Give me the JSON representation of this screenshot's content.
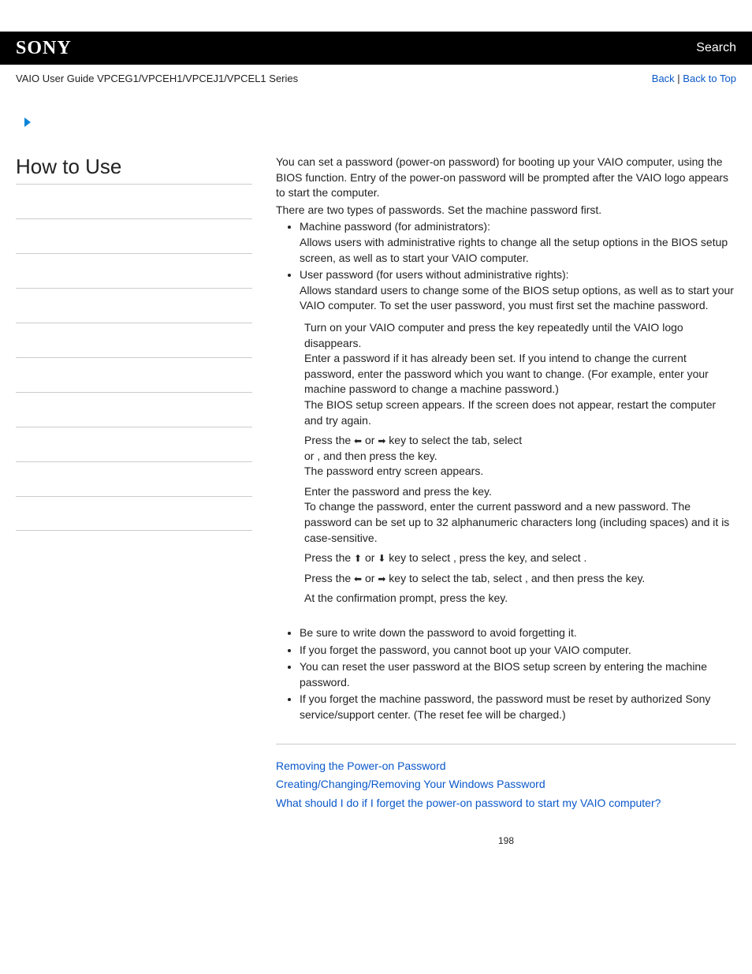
{
  "header": {
    "brand": "SONY",
    "search": "Search",
    "guide": "VAIO User Guide VPCEG1/VPCEH1/VPCEJ1/VPCEL1 Series",
    "back": "Back",
    "sep": " | ",
    "top": "Back to Top"
  },
  "side": {
    "title": "How to Use"
  },
  "intro": {
    "p1": "You can set a password (power-on password) for booting up your VAIO computer, using the BIOS function. Entry of the power-on password will be prompted after the VAIO logo appears to start the computer.",
    "p2": "There are two types of passwords. Set the machine password first."
  },
  "types": {
    "t1a": "Machine password (for administrators):",
    "t1b": "Allows users with administrative rights to change all the setup options in the BIOS setup screen, as well as to start your VAIO computer.",
    "t2a": "User password (for users without administrative rights):",
    "t2b": "Allows standard users to change some of the BIOS setup options, as well as to start your VAIO computer. To set the user password, you must first set the machine password."
  },
  "steps": {
    "s1a": "Turn on your VAIO computer and press the ",
    "s1b": " key repeatedly until the VAIO logo disappears.",
    "s1c": "Enter a password if it has already been set. If you intend to change the current password, enter the password which you want to change. (For example, enter your machine password to change a machine password.)",
    "s1d": "The BIOS setup screen appears. If the screen does not appear, restart the computer and try again.",
    "s2a": "Press the ",
    "s2or": " or ",
    "s2b": " key to select the ",
    "s2c": " tab, select ",
    "s2d": " or ",
    "s2e": ", and then press the ",
    "s2f": " key.",
    "s2g": "The password entry screen appears.",
    "s3a": "Enter the password and press the ",
    "s3b": " key.",
    "s3c": "To change the password, enter the current password and a new password. The password can be set up to 32 alphanumeric characters long (including spaces) and it is case-sensitive.",
    "s4a": "Press the ",
    "s4b": " key to select ",
    "s4c": ", press the ",
    "s4d": " key, and select ",
    "s4e": ".",
    "s5a": "Press the ",
    "s5b": " key to select the ",
    "s5c": " tab, select ",
    "s5d": ", and then press the ",
    "s5e": " key.",
    "s6a": "At the confirmation prompt, press the ",
    "s6b": " key."
  },
  "notes": {
    "n1": "Be sure to write down the password to avoid forgetting it.",
    "n2": "If you forget the password, you cannot boot up your VAIO computer.",
    "n3": "You can reset the user password at the BIOS setup screen by entering the machine password.",
    "n4": "If you forget the machine password, the password must be reset by authorized Sony service/support center. (The reset fee will be charged.)"
  },
  "related": {
    "r1": "Removing the Power-on Password",
    "r2": "Creating/Changing/Removing Your Windows Password",
    "r3": "What should I do if I forget the power-on password to start my VAIO computer?"
  },
  "page": "198"
}
